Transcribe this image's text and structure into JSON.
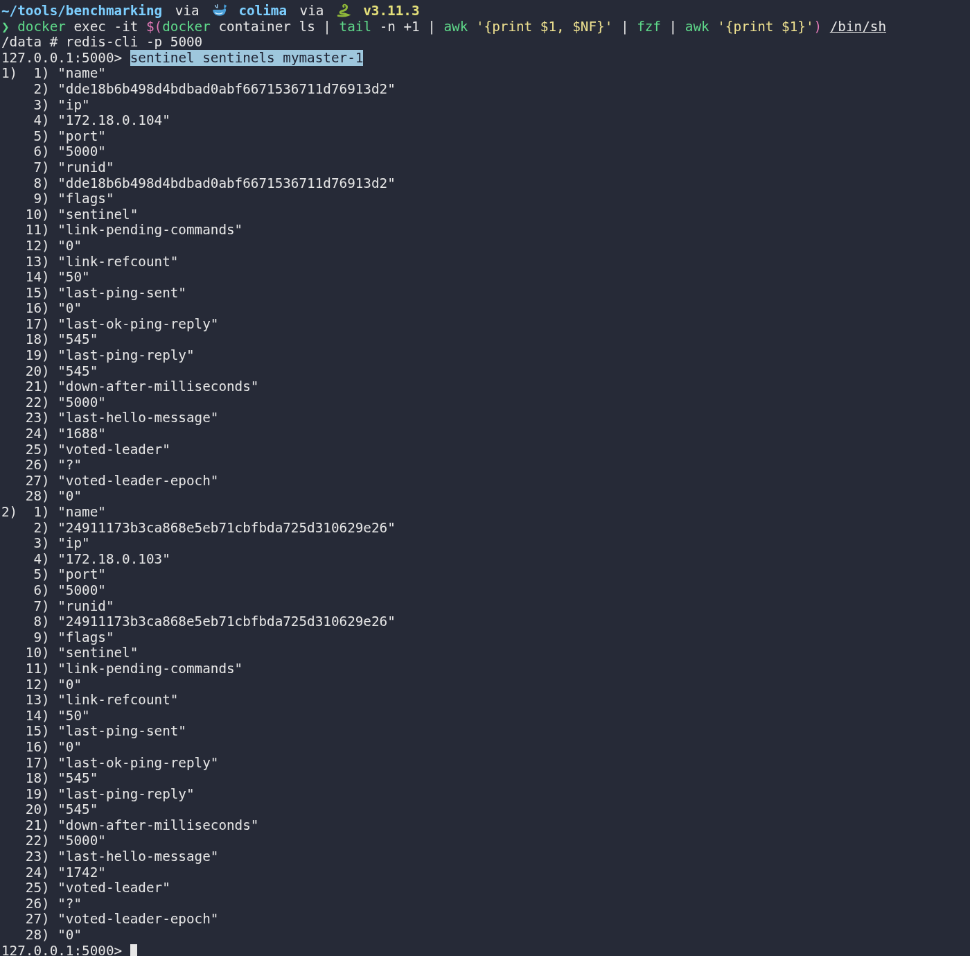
{
  "prompt_line": {
    "path": "~/tools/benchmarking",
    "via_1": "via",
    "context": "colima",
    "via_2": "via",
    "version": "v3.11.3"
  },
  "command_line": {
    "prompt_symbol": "❯",
    "tokens": [
      {
        "kind": "command",
        "text": "docker"
      },
      {
        "kind": "plain",
        "text": "exec -it"
      },
      {
        "kind": "subshell",
        "text": "$("
      },
      {
        "kind": "command",
        "text": "docker",
        "join": true
      },
      {
        "kind": "plain",
        "text": "container ls |"
      },
      {
        "kind": "command",
        "text": "tail"
      },
      {
        "kind": "plain",
        "text": "-n +1 |"
      },
      {
        "kind": "command",
        "text": "awk"
      },
      {
        "kind": "string",
        "text": "'{print $1, $NF}'"
      },
      {
        "kind": "plain",
        "text": "|"
      },
      {
        "kind": "command",
        "text": "fzf"
      },
      {
        "kind": "plain",
        "text": "|"
      },
      {
        "kind": "command",
        "text": "awk"
      },
      {
        "kind": "string",
        "text": "'{print $1}'"
      },
      {
        "kind": "subshell",
        "text": ")",
        "join": true
      },
      {
        "kind": "path",
        "text": "/bin/sh"
      }
    ]
  },
  "shell_line": "/data # redis-cli -p 5000",
  "redis_prompt": "127.0.0.1:5000>",
  "redis_command": {
    "text": "sentinel sentinels mymaster-1",
    "highlighted": true
  },
  "results": [
    {
      "index": "1)",
      "items": [
        {
          "index": "1)",
          "value": "\"name\""
        },
        {
          "index": "2)",
          "value": "\"dde18b6b498d4bdbad0abf6671536711d76913d2\""
        },
        {
          "index": "3)",
          "value": "\"ip\""
        },
        {
          "index": "4)",
          "value": "\"172.18.0.104\""
        },
        {
          "index": "5)",
          "value": "\"port\""
        },
        {
          "index": "6)",
          "value": "\"5000\""
        },
        {
          "index": "7)",
          "value": "\"runid\""
        },
        {
          "index": "8)",
          "value": "\"dde18b6b498d4bdbad0abf6671536711d76913d2\""
        },
        {
          "index": "9)",
          "value": "\"flags\""
        },
        {
          "index": "10)",
          "value": "\"sentinel\""
        },
        {
          "index": "11)",
          "value": "\"link-pending-commands\""
        },
        {
          "index": "12)",
          "value": "\"0\""
        },
        {
          "index": "13)",
          "value": "\"link-refcount\""
        },
        {
          "index": "14)",
          "value": "\"50\""
        },
        {
          "index": "15)",
          "value": "\"last-ping-sent\""
        },
        {
          "index": "16)",
          "value": "\"0\""
        },
        {
          "index": "17)",
          "value": "\"last-ok-ping-reply\""
        },
        {
          "index": "18)",
          "value": "\"545\""
        },
        {
          "index": "19)",
          "value": "\"last-ping-reply\""
        },
        {
          "index": "20)",
          "value": "\"545\""
        },
        {
          "index": "21)",
          "value": "\"down-after-milliseconds\""
        },
        {
          "index": "22)",
          "value": "\"5000\""
        },
        {
          "index": "23)",
          "value": "\"last-hello-message\""
        },
        {
          "index": "24)",
          "value": "\"1688\""
        },
        {
          "index": "25)",
          "value": "\"voted-leader\""
        },
        {
          "index": "26)",
          "value": "\"?\""
        },
        {
          "index": "27)",
          "value": "\"voted-leader-epoch\""
        },
        {
          "index": "28)",
          "value": "\"0\""
        }
      ]
    },
    {
      "index": "2)",
      "items": [
        {
          "index": "1)",
          "value": "\"name\""
        },
        {
          "index": "2)",
          "value": "\"24911173b3ca868e5eb71cbfbda725d310629e26\""
        },
        {
          "index": "3)",
          "value": "\"ip\""
        },
        {
          "index": "4)",
          "value": "\"172.18.0.103\""
        },
        {
          "index": "5)",
          "value": "\"port\""
        },
        {
          "index": "6)",
          "value": "\"5000\""
        },
        {
          "index": "7)",
          "value": "\"runid\""
        },
        {
          "index": "8)",
          "value": "\"24911173b3ca868e5eb71cbfbda725d310629e26\""
        },
        {
          "index": "9)",
          "value": "\"flags\""
        },
        {
          "index": "10)",
          "value": "\"sentinel\""
        },
        {
          "index": "11)",
          "value": "\"link-pending-commands\""
        },
        {
          "index": "12)",
          "value": "\"0\""
        },
        {
          "index": "13)",
          "value": "\"link-refcount\""
        },
        {
          "index": "14)",
          "value": "\"50\""
        },
        {
          "index": "15)",
          "value": "\"last-ping-sent\""
        },
        {
          "index": "16)",
          "value": "\"0\""
        },
        {
          "index": "17)",
          "value": "\"last-ok-ping-reply\""
        },
        {
          "index": "18)",
          "value": "\"545\""
        },
        {
          "index": "19)",
          "value": "\"last-ping-reply\""
        },
        {
          "index": "20)",
          "value": "\"545\""
        },
        {
          "index": "21)",
          "value": "\"down-after-milliseconds\""
        },
        {
          "index": "22)",
          "value": "\"5000\""
        },
        {
          "index": "23)",
          "value": "\"last-hello-message\""
        },
        {
          "index": "24)",
          "value": "\"1742\""
        },
        {
          "index": "25)",
          "value": "\"voted-leader\""
        },
        {
          "index": "26)",
          "value": "\"?\""
        },
        {
          "index": "27)",
          "value": "\"voted-leader-epoch\""
        },
        {
          "index": "28)",
          "value": "\"0\""
        }
      ]
    }
  ],
  "final_prompt": "127.0.0.1:5000>"
}
